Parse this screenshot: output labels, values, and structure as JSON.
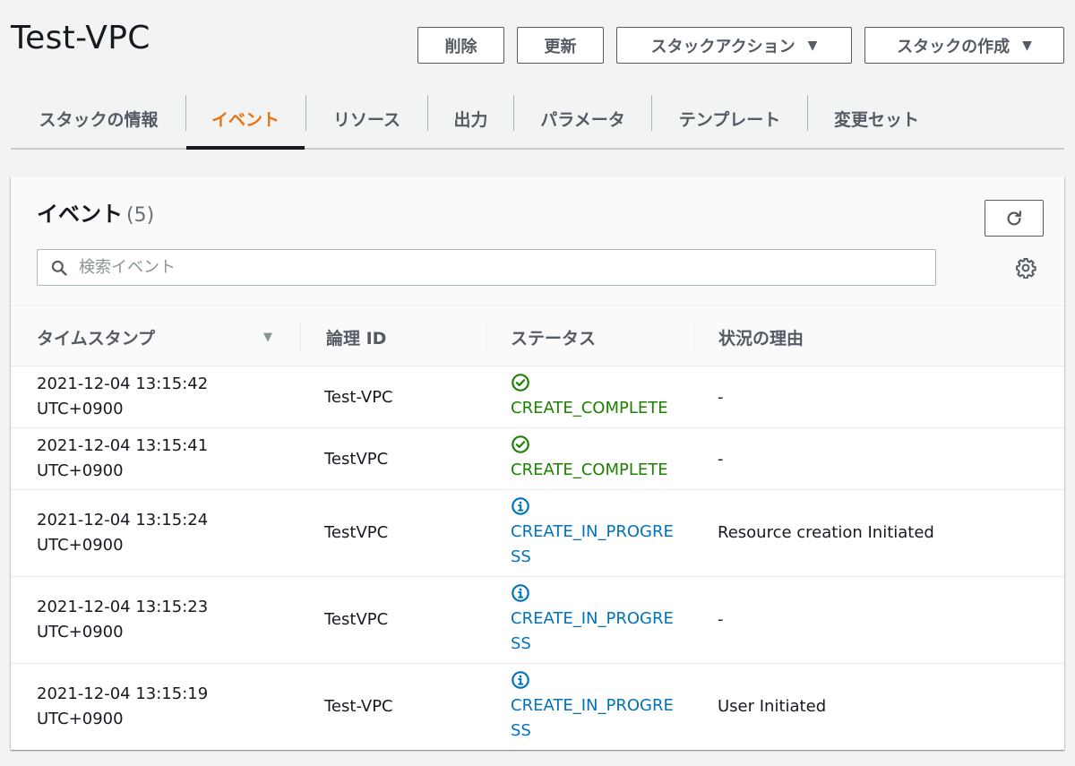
{
  "header": {
    "title": "Test-VPC",
    "buttons": {
      "delete": "削除",
      "update": "更新",
      "stack_actions": "スタックアクション",
      "create_stack": "スタックの作成"
    }
  },
  "tabs": [
    {
      "label": "スタックの情報"
    },
    {
      "label": "イベント",
      "active": true
    },
    {
      "label": "リソース"
    },
    {
      "label": "出力"
    },
    {
      "label": "パラメータ"
    },
    {
      "label": "テンプレート"
    },
    {
      "label": "変更セット"
    }
  ],
  "events_panel": {
    "title": "イベント",
    "count": "(5)",
    "search_placeholder": "検索イベント",
    "columns": [
      "タイムスタンプ",
      "論理 ID",
      "ステータス",
      "状況の理由"
    ],
    "rows": [
      {
        "date": "2021-12-04 13:15:42",
        "tz": "UTC+0900",
        "logical_id": "Test-VPC",
        "status": "CREATE_COMPLETE",
        "status_type": "success",
        "reason": "-"
      },
      {
        "date": "2021-12-04 13:15:41",
        "tz": "UTC+0900",
        "logical_id": "TestVPC",
        "status": "CREATE_COMPLETE",
        "status_type": "success",
        "reason": "-"
      },
      {
        "date": "2021-12-04 13:15:24",
        "tz": "UTC+0900",
        "logical_id": "TestVPC",
        "status": "CREATE_IN_PROGRESS",
        "status_type": "info",
        "reason": "Resource creation Initiated"
      },
      {
        "date": "2021-12-04 13:15:23",
        "tz": "UTC+0900",
        "logical_id": "TestVPC",
        "status": "CREATE_IN_PROGRESS",
        "status_type": "info",
        "reason": "-"
      },
      {
        "date": "2021-12-04 13:15:19",
        "tz": "UTC+0900",
        "logical_id": "Test-VPC",
        "status": "CREATE_IN_PROGRESS",
        "status_type": "info",
        "reason": "User Initiated"
      }
    ]
  },
  "colors": {
    "accent_active_tab": "#ec7211",
    "success": "#1d8102",
    "info": "#0073bb"
  },
  "icons": {
    "success": "check-circle-icon",
    "info": "info-circle-icon",
    "search": "search-icon",
    "refresh": "refresh-icon",
    "settings": "gear-icon",
    "sort": "sort-descending-icon",
    "dropdown": "caret-down-icon"
  }
}
